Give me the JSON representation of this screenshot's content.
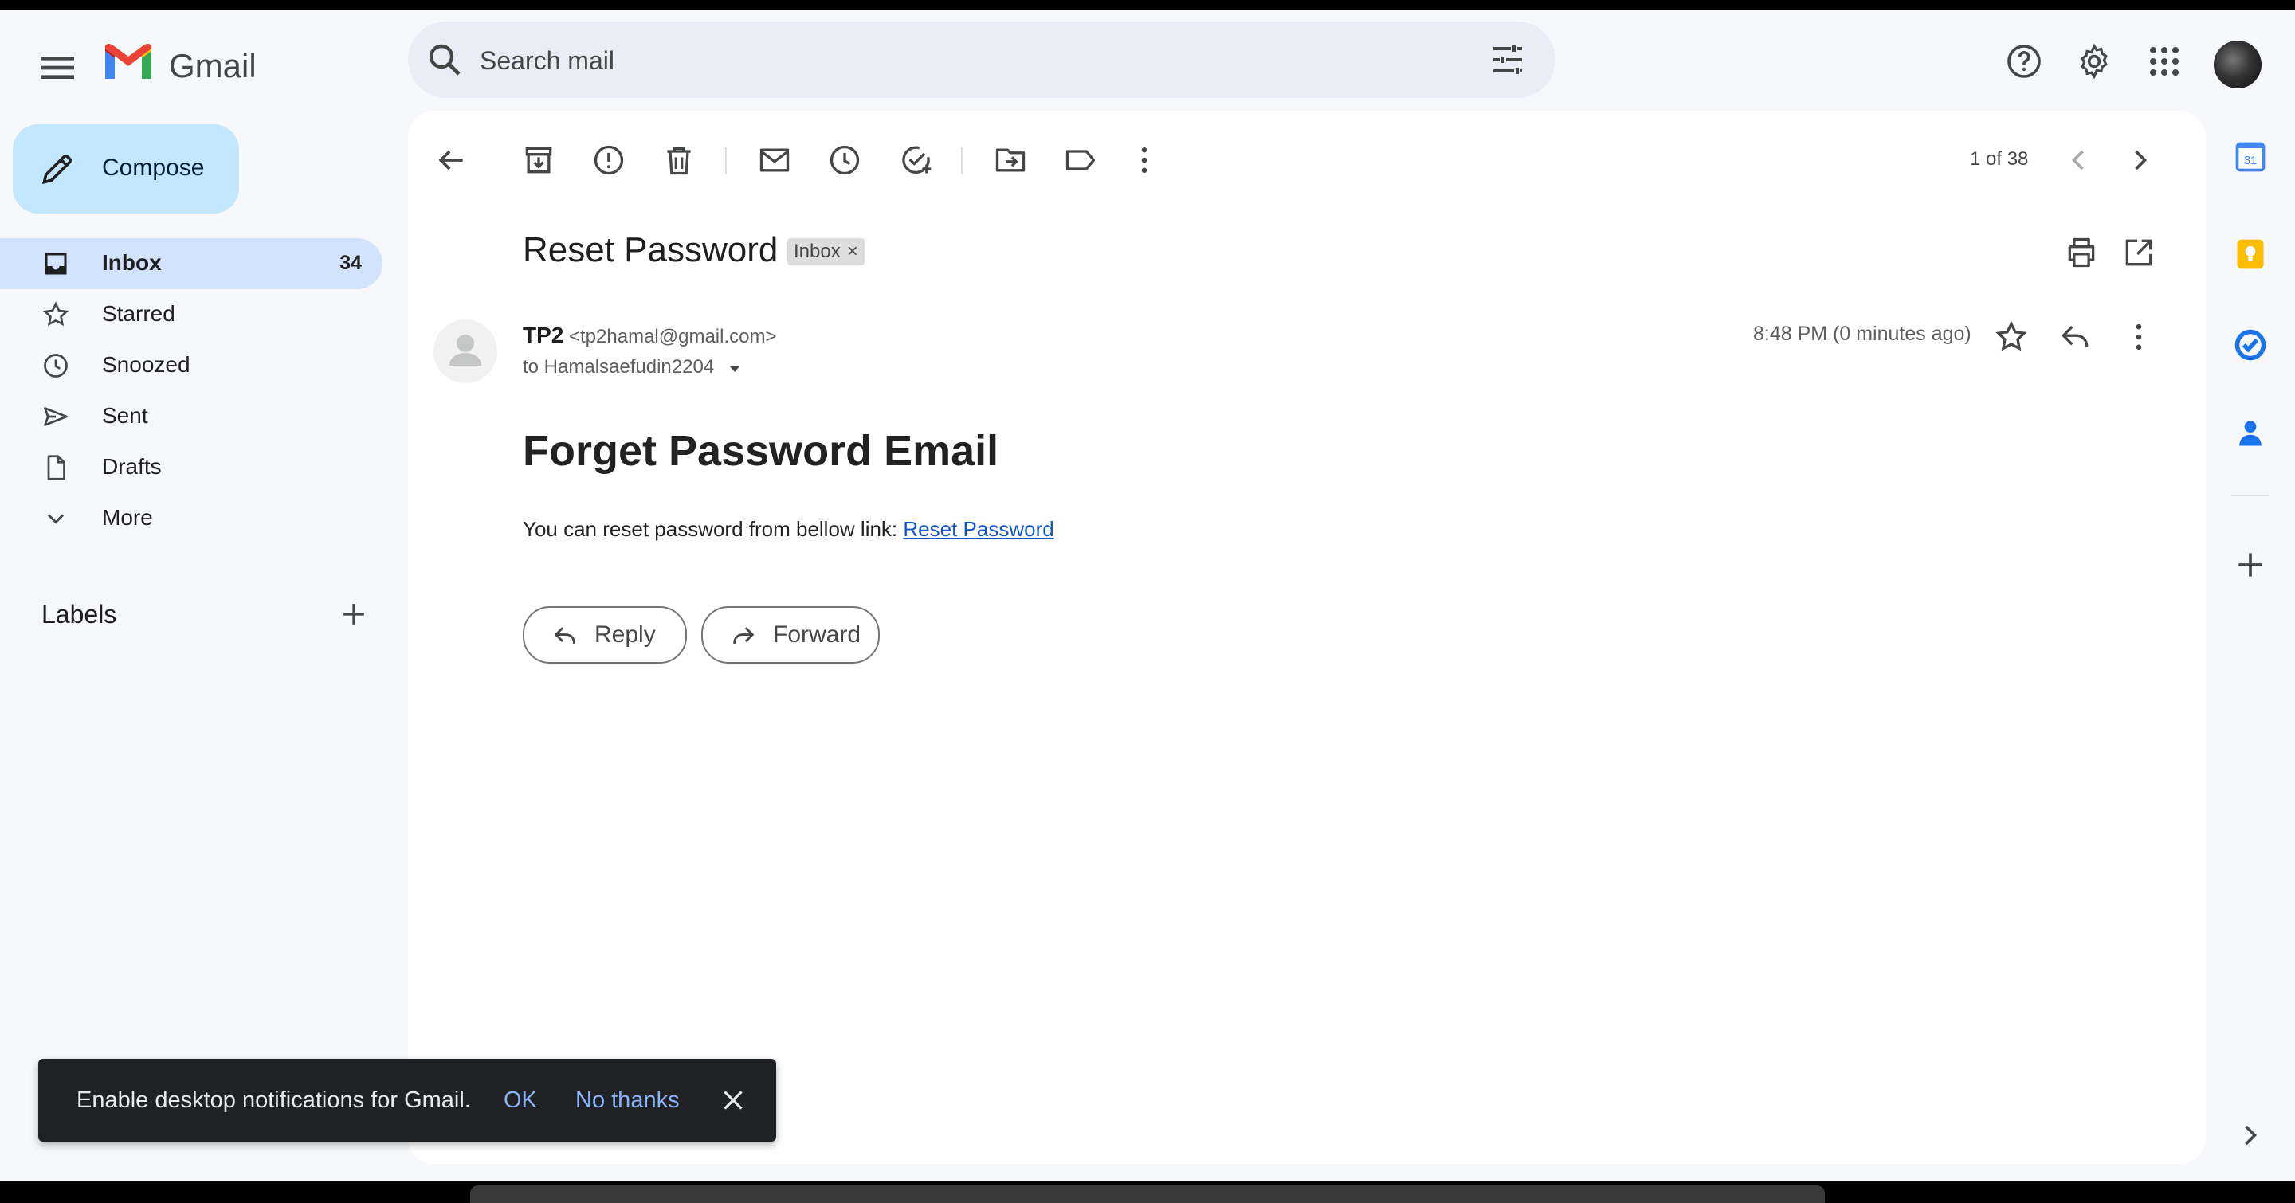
{
  "app": {
    "name": "Gmail",
    "brand_colors": {
      "red": "#ea4335",
      "blue": "#4285f4",
      "green": "#34a853",
      "yellow": "#fbbc04"
    }
  },
  "search": {
    "placeholder": "Search mail",
    "value": ""
  },
  "header_icons": [
    "help-icon",
    "settings-icon",
    "apps-icon",
    "account-avatar"
  ],
  "compose": {
    "label": "Compose"
  },
  "nav": {
    "items": [
      {
        "id": "inbox",
        "label": "Inbox",
        "count": "34",
        "icon": "inbox-icon",
        "active": true
      },
      {
        "id": "starred",
        "label": "Starred",
        "icon": "star-icon"
      },
      {
        "id": "snoozed",
        "label": "Snoozed",
        "icon": "clock-icon"
      },
      {
        "id": "sent",
        "label": "Sent",
        "icon": "send-icon"
      },
      {
        "id": "drafts",
        "label": "Drafts",
        "icon": "draft-icon"
      },
      {
        "id": "more",
        "label": "More",
        "icon": "chevron-down-icon"
      }
    ],
    "labels_title": "Labels"
  },
  "toolbar": {
    "pager": "1 of 38",
    "icons": [
      "back-icon",
      "archive-icon",
      "report-spam-icon",
      "delete-icon",
      "mark-unread-icon",
      "snooze-icon",
      "add-task-icon",
      "move-to-icon",
      "label-icon",
      "more-vert-icon"
    ]
  },
  "email": {
    "subject": "Reset Password",
    "label_chip": "Inbox",
    "label_chip_close": "×",
    "sender_name": "TP2",
    "sender_email": "<tp2hamal@gmail.com>",
    "recipient": "to Hamalsaefudin2204",
    "timestamp": "8:48 PM (0 minutes ago)",
    "heading": "Forget Password Email",
    "body_text": "You can reset password from bellow link: ",
    "link_text": "Reset Password",
    "reply_label": "Reply",
    "forward_label": "Forward"
  },
  "side_panel": {
    "icons": [
      "calendar-icon",
      "keep-icon",
      "tasks-icon",
      "contacts-icon",
      "add-addon-icon",
      "expand-panel-icon"
    ],
    "calendar_day": "31"
  },
  "snackbar": {
    "message": "Enable desktop notifications for Gmail.",
    "ok_label": "OK",
    "no_label": "No thanks"
  }
}
